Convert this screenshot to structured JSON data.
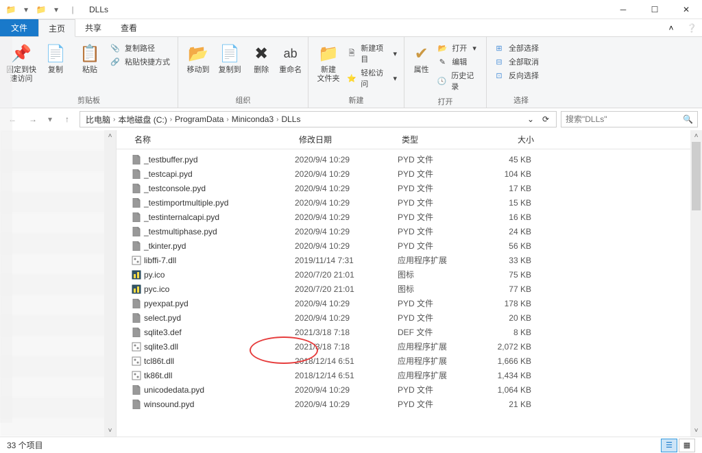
{
  "window": {
    "title": "DLLs"
  },
  "menu": {
    "file": "文件",
    "tabs": [
      "主页",
      "共享",
      "查看"
    ]
  },
  "ribbon": {
    "groups": {
      "clipboard": {
        "label": "剪贴板",
        "pin": "固定到快\n速访问",
        "copy": "复制",
        "paste": "粘贴",
        "copyPath": "复制路径",
        "pasteShortcut": "粘贴快捷方式"
      },
      "organize": {
        "label": "组织",
        "moveTo": "移动到",
        "copyTo": "复制到",
        "delete": "删除",
        "rename": "重命名"
      },
      "new": {
        "label": "新建",
        "newFolder": "新建\n文件夹",
        "newItem": "新建项目",
        "easyAccess": "轻松访问"
      },
      "open": {
        "label": "打开",
        "properties": "属性",
        "open": "打开",
        "edit": "编辑",
        "history": "历史记录"
      },
      "select": {
        "label": "选择",
        "selectAll": "全部选择",
        "selectNone": "全部取消",
        "invert": "反向选择"
      }
    }
  },
  "breadcrumb": {
    "items": [
      "比电脑",
      "本地磁盘 (C:)",
      "ProgramData",
      "Miniconda3",
      "DLLs"
    ]
  },
  "search": {
    "placeholder": "搜索\"DLLs\""
  },
  "columns": {
    "name": "名称",
    "modified": "修改日期",
    "type": "类型",
    "size": "大小"
  },
  "types": {
    "pyd": "PYD 文件",
    "dll": "应用程序扩展",
    "ico": "图标",
    "def": "DEF 文件"
  },
  "files": [
    {
      "icon": "doc",
      "name": "_testbuffer.pyd",
      "date": "2020/9/4 10:29",
      "type": "PYD 文件",
      "size": "45 KB"
    },
    {
      "icon": "doc",
      "name": "_testcapi.pyd",
      "date": "2020/9/4 10:29",
      "type": "PYD 文件",
      "size": "104 KB"
    },
    {
      "icon": "doc",
      "name": "_testconsole.pyd",
      "date": "2020/9/4 10:29",
      "type": "PYD 文件",
      "size": "17 KB"
    },
    {
      "icon": "doc",
      "name": "_testimportmultiple.pyd",
      "date": "2020/9/4 10:29",
      "type": "PYD 文件",
      "size": "15 KB"
    },
    {
      "icon": "doc",
      "name": "_testinternalcapi.pyd",
      "date": "2020/9/4 10:29",
      "type": "PYD 文件",
      "size": "16 KB"
    },
    {
      "icon": "doc",
      "name": "_testmultiphase.pyd",
      "date": "2020/9/4 10:29",
      "type": "PYD 文件",
      "size": "24 KB"
    },
    {
      "icon": "doc",
      "name": "_tkinter.pyd",
      "date": "2020/9/4 10:29",
      "type": "PYD 文件",
      "size": "56 KB"
    },
    {
      "icon": "dll",
      "name": "libffi-7.dll",
      "date": "2019/11/14 7:31",
      "type": "应用程序扩展",
      "size": "33 KB"
    },
    {
      "icon": "ico",
      "name": "py.ico",
      "date": "2020/7/20 21:01",
      "type": "图标",
      "size": "75 KB"
    },
    {
      "icon": "ico",
      "name": "pyc.ico",
      "date": "2020/7/20 21:01",
      "type": "图标",
      "size": "77 KB"
    },
    {
      "icon": "doc",
      "name": "pyexpat.pyd",
      "date": "2020/9/4 10:29",
      "type": "PYD 文件",
      "size": "178 KB"
    },
    {
      "icon": "doc",
      "name": "select.pyd",
      "date": "2020/9/4 10:29",
      "type": "PYD 文件",
      "size": "20 KB"
    },
    {
      "icon": "doc",
      "name": "sqlite3.def",
      "date": "2021/3/18 7:18",
      "type": "DEF 文件",
      "size": "8 KB"
    },
    {
      "icon": "dll",
      "name": "sqlite3.dll",
      "date": "2021/3/18 7:18",
      "type": "应用程序扩展",
      "size": "2,072 KB"
    },
    {
      "icon": "dll",
      "name": "tcl86t.dll",
      "date": "2018/12/14 6:51",
      "type": "应用程序扩展",
      "size": "1,666 KB"
    },
    {
      "icon": "dll",
      "name": "tk86t.dll",
      "date": "2018/12/14 6:51",
      "type": "应用程序扩展",
      "size": "1,434 KB"
    },
    {
      "icon": "doc",
      "name": "unicodedata.pyd",
      "date": "2020/9/4 10:29",
      "type": "PYD 文件",
      "size": "1,064 KB"
    },
    {
      "icon": "doc",
      "name": "winsound.pyd",
      "date": "2020/9/4 10:29",
      "type": "PYD 文件",
      "size": "21 KB"
    }
  ],
  "status": {
    "itemCount": "33 个项目"
  }
}
